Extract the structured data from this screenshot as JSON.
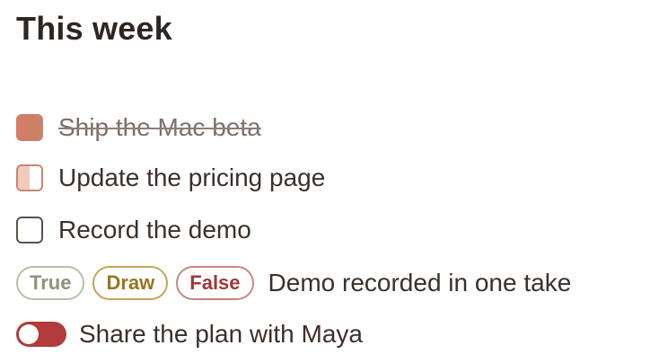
{
  "header": {
    "title": "This week"
  },
  "tasks": [
    {
      "label": "Ship the Mac beta",
      "state": "checked"
    },
    {
      "label": "Update the pricing page",
      "state": "partial"
    },
    {
      "label": "Record the demo",
      "state": "unchecked"
    }
  ],
  "verdict": {
    "options": [
      "True",
      "Draw",
      "False"
    ],
    "statement": "Demo recorded in one take"
  },
  "share": {
    "label": "Share the plan with Maya",
    "toggle_on": false
  },
  "colors": {
    "checked": "#cf7f66",
    "partial": "#f2cbbf",
    "toggle_track": "#b23b3b",
    "chip_true": "#8d9279",
    "chip_draw": "#9a7423",
    "chip_false": "#9b3a35"
  },
  "icons": {
    "checked": "checkbox-checked-icon",
    "partial": "checkbox-partial-icon",
    "unchecked": "checkbox-empty-icon",
    "toggle": "toggle-switch-icon"
  }
}
